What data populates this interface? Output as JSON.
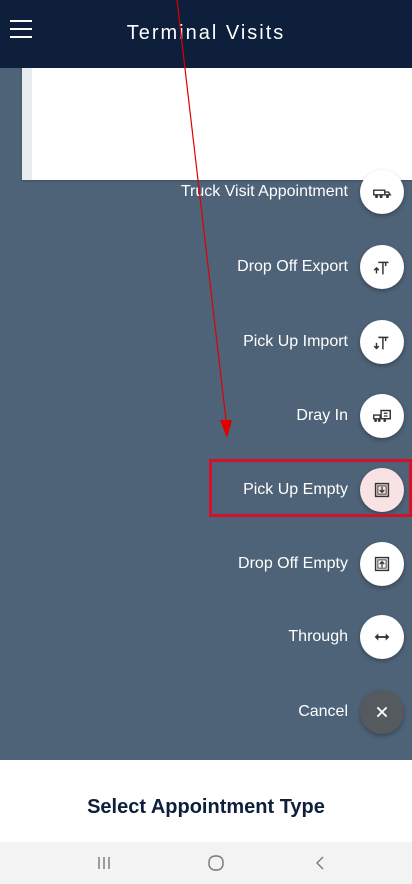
{
  "header": {
    "title": "Terminal Visits",
    "menu_icon": "hamburger-icon"
  },
  "fab_menu": {
    "items": [
      {
        "label": "Truck Visit Appointment",
        "icon": "truck-icon"
      },
      {
        "label": "Drop Off Export",
        "icon": "crane-drop-icon"
      },
      {
        "label": "Pick Up Import",
        "icon": "crane-pick-icon"
      },
      {
        "label": "Dray In",
        "icon": "container-truck-icon"
      },
      {
        "label": "Pick Up Empty",
        "icon": "container-down-icon"
      },
      {
        "label": "Drop Off Empty",
        "icon": "container-up-icon"
      },
      {
        "label": "Through",
        "icon": "double-arrow-icon"
      },
      {
        "label": "Cancel",
        "icon": "close-icon"
      }
    ]
  },
  "bottom_title": "Select Appointment Type",
  "nav": {
    "recent": "|||",
    "home": "○",
    "back": "<"
  },
  "colors": {
    "header": "#0d1f3a",
    "overlay": "#4e6378",
    "highlight": "#d6102a",
    "annotation": "#e00000"
  }
}
